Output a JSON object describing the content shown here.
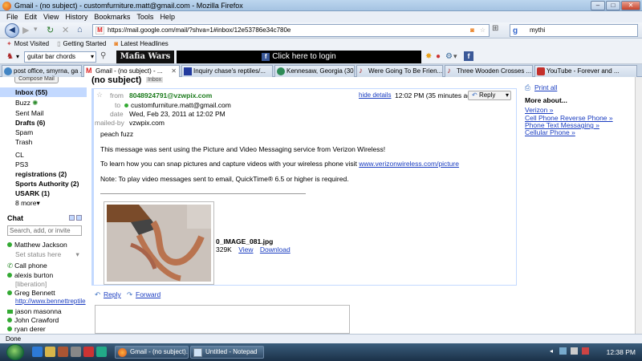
{
  "window": {
    "title": "Gmail - (no subject) - customfurniture.matt@gmail.com - Mozilla Firefox"
  },
  "menu": [
    "File",
    "Edit",
    "View",
    "History",
    "Bookmarks",
    "Tools",
    "Help"
  ],
  "nav": {
    "url": "https://mail.google.com/mail/?shva=1#inbox/12e53786e34c780e",
    "search": "mythi"
  },
  "bookmarks": [
    "Most Visited",
    "Getting Started",
    "Latest Headlines"
  ],
  "addon": {
    "select_value": "guitar bar chords",
    "mafia": "Mafia Wars",
    "fb_login": "Click here to login"
  },
  "tabs": [
    "post office, smyrna, ga ...",
    "Gmail - (no subject) - ...",
    "Inquiry chase's reptiles/...",
    "Kennesaw, Georgia (30...",
    "Were Going To Be Frien...",
    "Three Wooden Crosses ...",
    "YouTube - Forever and ..."
  ],
  "leftnav": {
    "compose": "Compose Mail",
    "items": [
      {
        "label": "Inbox (55)",
        "bold": true
      },
      {
        "label": "Buzz",
        "bold": false
      },
      {
        "label": "Sent Mail",
        "bold": false
      },
      {
        "label": "Drafts (6)",
        "bold": true
      },
      {
        "label": "Spam",
        "bold": false
      },
      {
        "label": "Trash",
        "bold": false
      },
      {
        "label": "CL",
        "bold": false
      },
      {
        "label": "PS3",
        "bold": false
      },
      {
        "label": "registrations (2)",
        "bold": true
      },
      {
        "label": "Sports Authority (2)",
        "bold": true
      },
      {
        "label": "USARK (1)",
        "bold": true
      },
      {
        "label": "8 more▾",
        "bold": false
      }
    ]
  },
  "chat": {
    "header": "Chat",
    "search_placeholder": "Search, add, or invite",
    "me": "Matthew Jackson",
    "status": "Set status here",
    "call_phone": "Call phone",
    "contacts": [
      {
        "name": "alexis burton",
        "sub": "[liberation]"
      },
      {
        "name": "Greg Bennett",
        "sub": "http://www.bennettreptile"
      },
      {
        "name": "jason masonna",
        "sub": ""
      },
      {
        "name": "John Crawford",
        "sub": ""
      },
      {
        "name": "ryan derer",
        "sub": ""
      }
    ]
  },
  "message": {
    "subject": "(no subject)",
    "label": "Inbox",
    "from_label": "from",
    "from": "8048924791@vzwpix.com",
    "to_label": "to",
    "to": "customfurniture.matt@gmail.com",
    "date_label": "date",
    "date": "Wed, Feb 23, 2011 at 12:02 PM",
    "mailedby_label": "mailed-by",
    "mailedby": "vzwpix.com",
    "hide_details": "hide details",
    "time": "12:02 PM (35 minutes ago)",
    "reply": "Reply",
    "body": [
      "peach fuzz",
      "This message was sent using the Picture and Video Messaging service from Verizon Wireless!",
      "To learn how you can snap pictures and capture videos with your wireless phone visit",
      "Note: To play video messages sent to email, QuickTime® 6.5 or higher is required."
    ],
    "body_link": "www.verizonwireless.com/picture",
    "attachment": {
      "name": "0_IMAGE_081.jpg",
      "size": "329K",
      "view": "View",
      "download": "Download"
    },
    "reply_link": "Reply",
    "forward_link": "Forward"
  },
  "right": {
    "print": "Print all",
    "more_about": "More about...",
    "links": [
      "Verizon »",
      "Cell Phone Reverse Phone »",
      "Phone Text Messaging »",
      "Cellular Phone »"
    ]
  },
  "status": "Done",
  "taskbar": {
    "tasks": [
      "Gmail - (no subject)...",
      "Untitled - Notepad"
    ],
    "clock": "12:38 PM"
  }
}
